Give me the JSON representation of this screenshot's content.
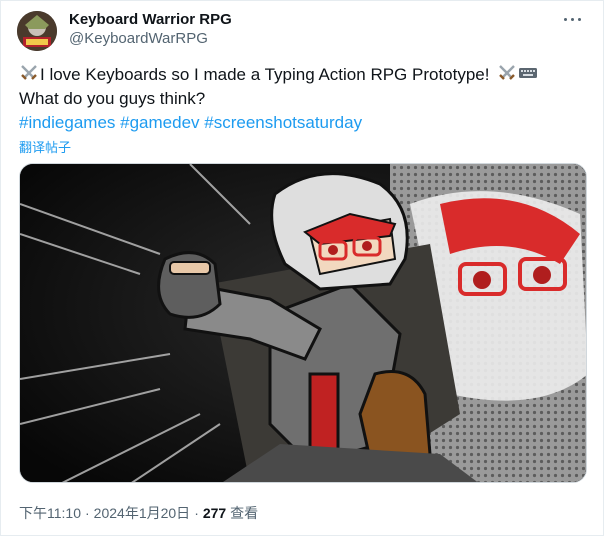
{
  "author": {
    "display_name": "Keyboard Warrior RPG",
    "handle": "@KeyboardWarRPG"
  },
  "menu": {
    "icon": "more-horizontal-icon"
  },
  "post": {
    "line1": "I love Keyboards so I made a Typing Action RPG Prototype!",
    "line2": "What do you guys think?",
    "emoji": [
      "crossed-swords-emoji",
      "crossed-swords-emoji",
      "keyboard-emoji"
    ],
    "hashtags": [
      "#indiegames",
      "#gamedev",
      "#screenshotsaturday"
    ]
  },
  "translate_label": "翻译帖子",
  "meta": {
    "time": "下午11:10",
    "date": "2024年1月20日",
    "views_count": "277",
    "views_label": "查看"
  },
  "colors": {
    "link": "#1d9bf0",
    "secondary_text": "#536471",
    "character_hair": "#d9d9d9",
    "character_accent": "#d92b2b"
  }
}
